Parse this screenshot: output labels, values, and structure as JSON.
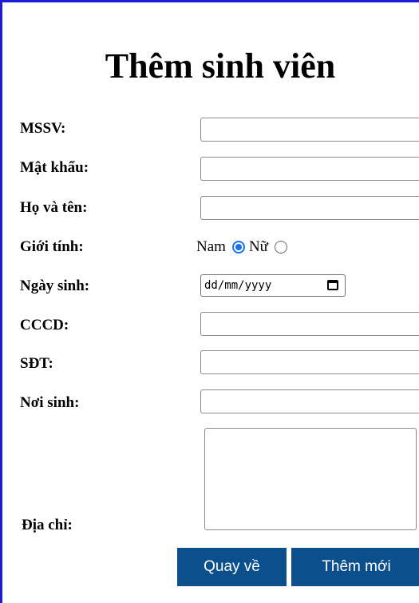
{
  "form": {
    "title": "Thêm sinh viên",
    "fields": {
      "mssv_label": "MSSV:",
      "mssv_value": "",
      "password_label": "Mật khẩu:",
      "password_value": "",
      "fullname_label": "Họ và tên:",
      "fullname_value": "",
      "gender_label": "Giới tính:",
      "gender_options": [
        {
          "label": "Nam",
          "selected": true
        },
        {
          "label": "Nữ",
          "selected": false
        }
      ],
      "dob_label": "Ngày sinh:",
      "dob_placeholder": "dd/mm/yyyy",
      "cccd_label": "CCCD:",
      "cccd_value": "",
      "phone_label": "SĐT:",
      "phone_value": "",
      "birthplace_label": "Nơi sinh:",
      "birthplace_value": "",
      "address_label": "Địa chỉ:",
      "address_value": ""
    },
    "buttons": {
      "back_label": "Quay về",
      "add_label": "Thêm mới"
    }
  },
  "colors": {
    "frame_border": "#1d1dd6",
    "button_bg": "#0b4f8c",
    "radio_accent": "#1a73e8"
  },
  "icons": {
    "date_picker": "calendar-icon",
    "textarea_resize": "resize-grip-icon"
  }
}
